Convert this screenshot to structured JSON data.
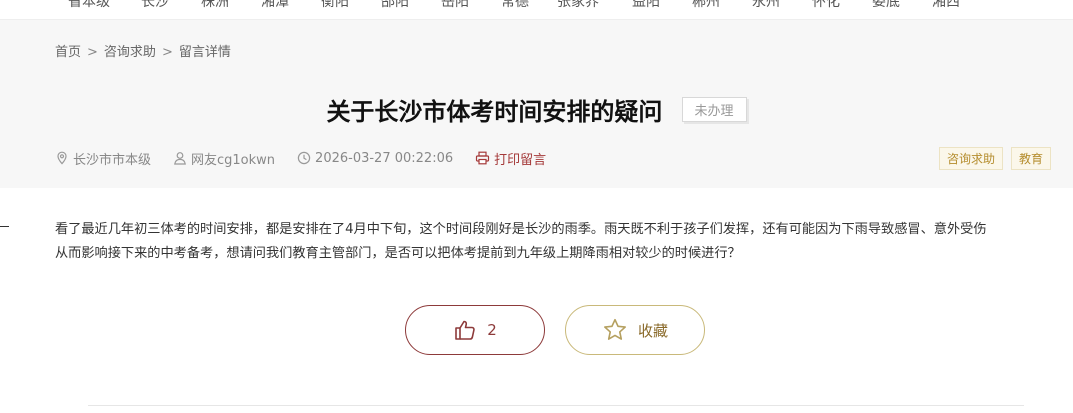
{
  "top_nav": {
    "items": [
      "省本级",
      "长沙",
      "株洲",
      "湘潭",
      "衡阳",
      "邵阳",
      "岳阳",
      "常德",
      "张家界",
      "益阳",
      "郴州",
      "永州",
      "怀化",
      "娄底",
      "湘西"
    ]
  },
  "breadcrumb": {
    "items": [
      "首页",
      "咨询求助",
      "留言详情"
    ],
    "separator": ">"
  },
  "message": {
    "title": "关于长沙市体考时间安排的疑问",
    "status": "未办理",
    "location": "长沙市市本级",
    "author": "网友cg1okwn",
    "datetime": "2026-03-27 00:22:06",
    "print_label": "打印留言",
    "tags": [
      "咨询求助",
      "教育"
    ],
    "content_lines": [
      "看了最近几年初三体考的时间安排，都是安排在了4月中下旬，这个时间段刚好是长沙的雨季。雨天既不利于孩子们发挥，还有可能因为下雨导致感冒、意外受伤",
      "从而影响接下来的中考备考，想请问我们教育主管部门，是否可以把体考提前到九年级上期降雨相对较少的时候进行？"
    ]
  },
  "actions": {
    "like_count": "2",
    "favorite_label": "收藏"
  },
  "colors": {
    "accent": "#8d3a3a",
    "gold": "#b58d2e",
    "header_bg": "#f7f7f7"
  },
  "icons": {
    "location": "location-pin-icon",
    "user": "user-icon",
    "time": "clock-icon",
    "print": "printer-icon",
    "like": "thumbs-up-icon",
    "favorite": "star-icon"
  }
}
